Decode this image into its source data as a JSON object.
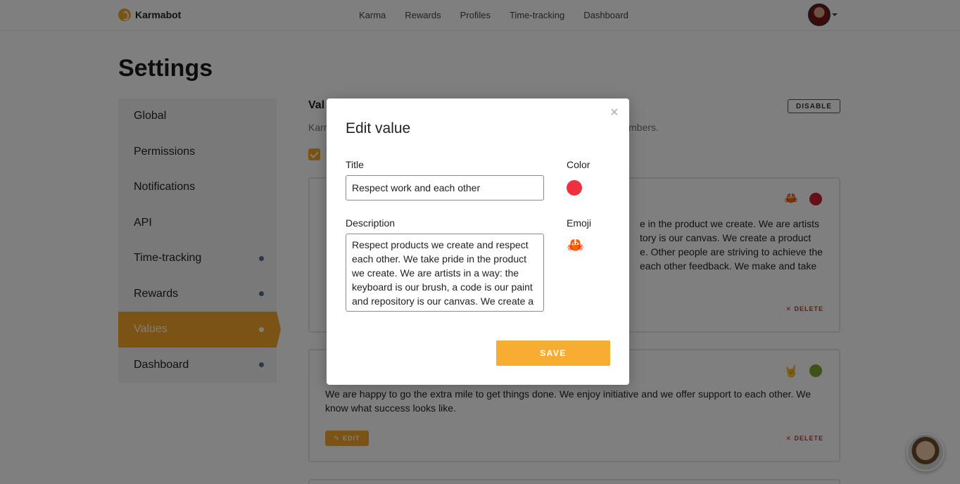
{
  "app": {
    "name": "Karmabot"
  },
  "nav": {
    "items": [
      "Karma",
      "Rewards",
      "Profiles",
      "Time-tracking",
      "Dashboard"
    ]
  },
  "page": {
    "title": "Settings"
  },
  "sidebar": {
    "items": [
      {
        "label": "Global",
        "dot": false,
        "active": false
      },
      {
        "label": "Permissions",
        "dot": false,
        "active": false
      },
      {
        "label": "Notifications",
        "dot": false,
        "active": false
      },
      {
        "label": "API",
        "dot": false,
        "active": false
      },
      {
        "label": "Time-tracking",
        "dot": true,
        "active": false
      },
      {
        "label": "Rewards",
        "dot": true,
        "active": false
      },
      {
        "label": "Values",
        "dot": true,
        "active": true
      },
      {
        "label": "Dashboard",
        "dot": true,
        "active": false
      }
    ]
  },
  "content": {
    "heading_visible": "Val",
    "subtitle_left": "Karr",
    "subtitle_right": "mbers.",
    "disable_label": "DISABLE",
    "cards": [
      {
        "emoji": "🦀",
        "color": "#cc1f2f",
        "description_visible_lines": [
          "e in the product we create. We are artists",
          "tory is our canvas. We create a product",
          "e. Other people are striving to achieve the",
          " each other feedback. We make and take"
        ],
        "delete_label": "DELETE"
      },
      {
        "emoji": "🤘",
        "color": "#7fa52f",
        "description": "We are happy to go the extra mile to get things done. We enjoy initiative and we offer support to each other. We know what success looks like.",
        "edit_label": "EDIT",
        "delete_label": "DELETE"
      }
    ]
  },
  "modal": {
    "title": "Edit value",
    "close_glyph": "×",
    "title_label": "Title",
    "title_value": "Respect work and each other",
    "color_label": "Color",
    "color_value": "#f0303f",
    "description_label": "Description",
    "description_value": "Respect products we create and respect each other. We take pride in the product we create. We are artists in a way: the keyboard is our brush, a code is our paint and repository is our canvas. We create a product",
    "emoji_label": "Emoji",
    "emoji_value": "🦀",
    "save_label": "SAVE"
  }
}
